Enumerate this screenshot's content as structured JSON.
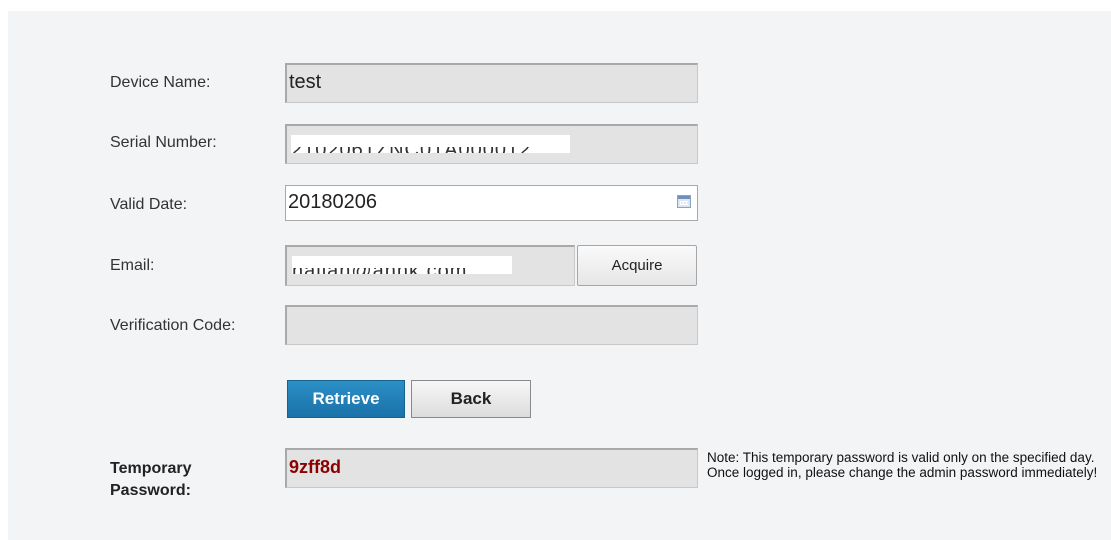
{
  "form": {
    "device_name": {
      "label": "Device Name:",
      "value": "test"
    },
    "serial_number": {
      "label": "Serial Number:",
      "value": "2102061ZNC01A000012"
    },
    "valid_date": {
      "label": "Valid Date:",
      "value": "20180206",
      "icon": "calendar-icon"
    },
    "email": {
      "label": "Email:",
      "value": "hajian@ahhk.com",
      "acquire_label": "Acquire"
    },
    "verification_code": {
      "label": "Verification Code:",
      "value": ""
    }
  },
  "actions": {
    "retrieve_label": "Retrieve",
    "back_label": "Back"
  },
  "result": {
    "label_line1": "Temporary",
    "label_line2": "Password:",
    "value": "9zff8d",
    "note": "Note: This temporary password is valid only on the specified day. Once logged in, please change the admin password immediately!"
  },
  "colors": {
    "panel_bg": "#f3f4f6",
    "field_bg": "#e3e3e3",
    "primary_button": "#1f7fb8",
    "password_text": "#8b0000"
  }
}
